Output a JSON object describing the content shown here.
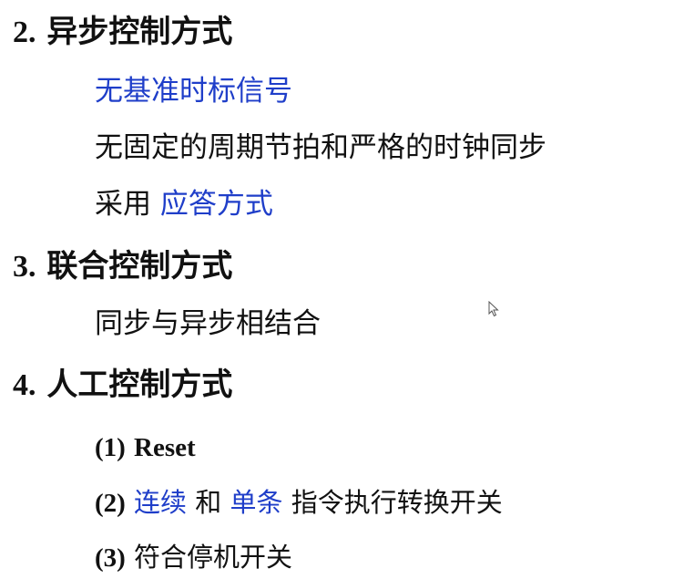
{
  "sections": [
    {
      "heading_num": "2.",
      "heading_text": "异步控制方式",
      "items": {
        "no_reference_signal": "无基准时标信号",
        "no_fixed_period": "无固定的周期节拍和严格的时钟同步",
        "adopt_prefix": "采用",
        "adopt_method": "应答方式"
      }
    },
    {
      "heading_num": "3.",
      "heading_text": "联合控制方式",
      "items": {
        "combined": "同步与异步相结合"
      }
    },
    {
      "heading_num": "4.",
      "heading_text": "人工控制方式",
      "items": {
        "item1_num": "(1)",
        "item1_text": "Reset",
        "item2_num": "(2)",
        "item2_term1": "连续",
        "item2_and": "和",
        "item2_term2": "单条",
        "item2_rest": "指令执行转换开关",
        "item3_num": "(3)",
        "item3_text": "符合停机开关"
      }
    }
  ],
  "colors": {
    "text": "#111111",
    "highlight": "#1f3ec9"
  },
  "icons": [
    "mouse-pointer-icon"
  ]
}
